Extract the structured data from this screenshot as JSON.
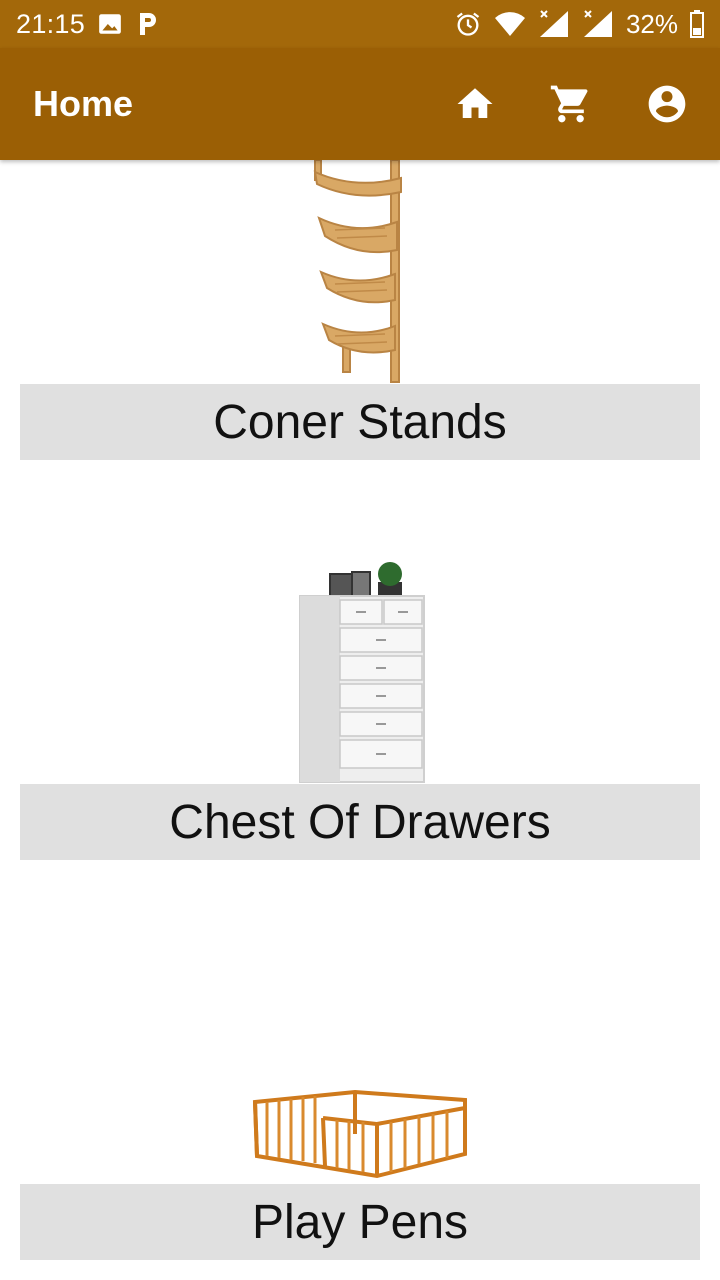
{
  "status_bar": {
    "time": "21:15",
    "battery_percent": "32%",
    "icons": [
      "image-icon",
      "p-icon",
      "alarm-icon",
      "wifi-icon",
      "signal-icon",
      "signal-icon",
      "battery-icon"
    ]
  },
  "app_bar": {
    "title": "Home",
    "actions": [
      "home-icon",
      "cart-icon",
      "account-icon"
    ]
  },
  "colors": {
    "status_bar_bg": "#a3680a",
    "app_bar_bg": "#9b5f05",
    "label_bg": "#e0e0e0"
  },
  "products": [
    {
      "name": "Coner Stands",
      "image": "corner-stand-image"
    },
    {
      "name": "Chest Of Drawers",
      "image": "chest-of-drawers-image"
    },
    {
      "name": "Play Pens",
      "image": "play-pen-image"
    }
  ]
}
